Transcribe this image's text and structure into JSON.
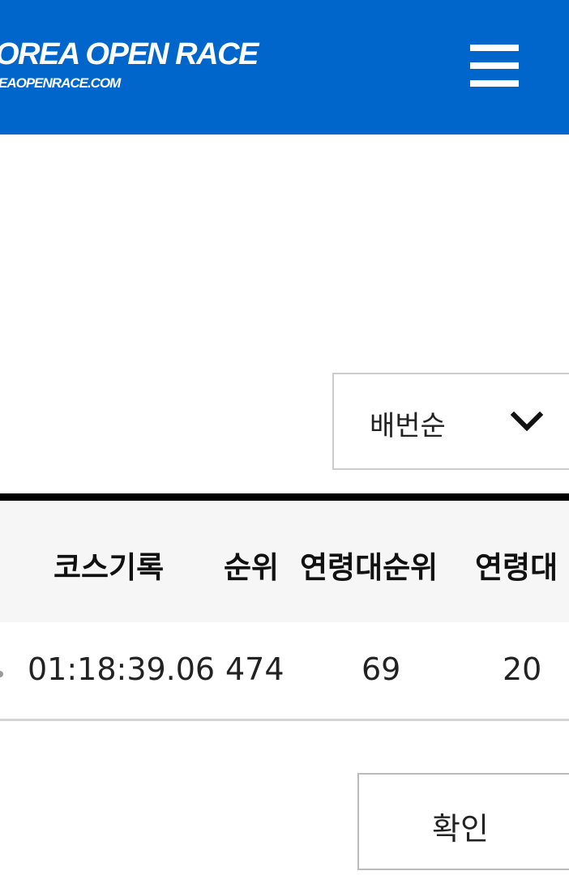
{
  "header": {
    "logo_title": "OREA OPEN RACE",
    "logo_url": "EAOPENRACE.COM",
    "menu_icon": "hamburger-menu-icon",
    "background_color": "#0066cc"
  },
  "sort": {
    "selected": "배번순",
    "icon": "chevron-down-icon"
  },
  "table": {
    "headers": [
      "코스기록",
      "순위",
      "연령대순위",
      "연령대"
    ],
    "rows": [
      [
        "01:18:39.06",
        "474",
        "69",
        "20"
      ]
    ]
  },
  "actions": {
    "confirm_label": "확인"
  }
}
